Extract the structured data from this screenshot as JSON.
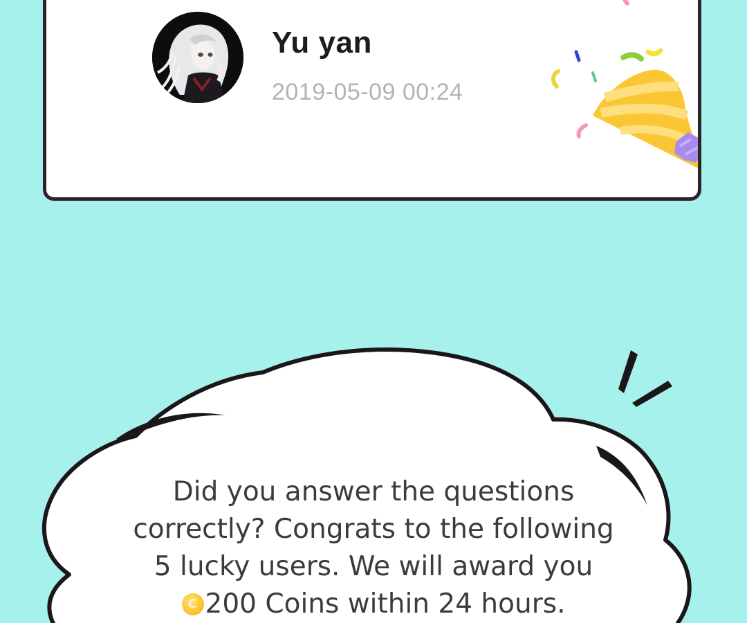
{
  "user_card": {
    "name": "Yu yan",
    "timestamp": "2019-05-09 00:24",
    "avatar_icon": "anime-avatar",
    "decoration_icon": "party-popper-icon"
  },
  "announcement": {
    "line1": "Did you answer the questions",
    "line2": "correctly? Congrats to the following",
    "line3": "5 lucky users. We will award you",
    "line4": "200 Coins within 24 hours.",
    "coin_icon": "coin-icon"
  },
  "colors": {
    "background": "#a6f1ec",
    "card_border": "#2c2326",
    "timestamp_text": "#b3b3b3",
    "body_text": "#3d3a3b",
    "popper_yellow": "#fbc634",
    "popper_ribbon": "#a98bf0"
  }
}
